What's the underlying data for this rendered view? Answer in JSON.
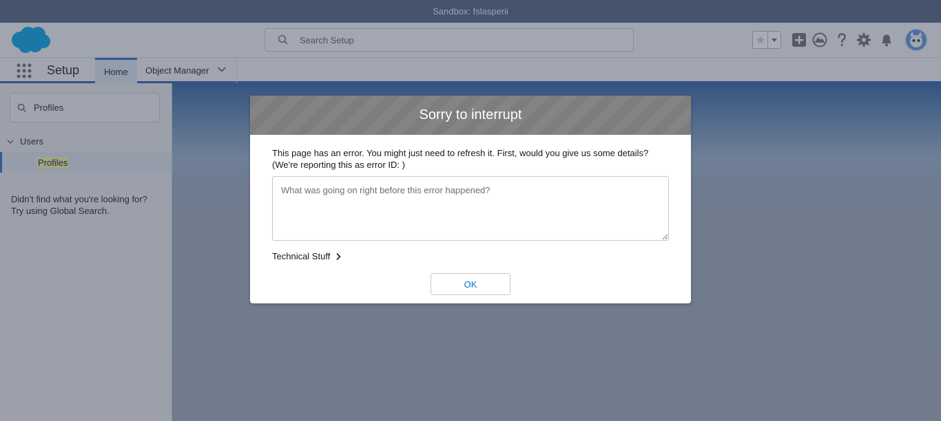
{
  "sandbox": {
    "label": "Sandbox: fslasperii"
  },
  "header": {
    "search_placeholder": "Search Setup",
    "icons": [
      "search-icon",
      "favorites-star-icon",
      "chevron-down-icon",
      "add-icon",
      "trailhead-icon",
      "help-icon",
      "gear-icon",
      "bell-icon",
      "avatar"
    ]
  },
  "context_nav": {
    "app_name": "Setup",
    "tabs": [
      {
        "label": "Home",
        "active": true
      },
      {
        "label": "Object Manager",
        "active": false
      }
    ]
  },
  "sidebar": {
    "quickfind_value": "Profiles",
    "tree": {
      "group_label": "Users",
      "item_label": "Profiles"
    },
    "not_found_line1": "Didn't find what you're looking for?",
    "not_found_line2": "Try using Global Search."
  },
  "modal": {
    "title": "Sorry to interrupt",
    "message_line1": "This page has an error. You might just need to refresh it. First, would you give us some details?",
    "message_line2": "(We're reporting this as error ID: )",
    "details_placeholder": "What was going on right before this error happened?",
    "technical_label": "Technical Stuff",
    "ok_label": "OK"
  },
  "colors": {
    "brand_blue": "#00a1e0",
    "link_blue": "#0070d2",
    "sandbox_bar": "#4f5d77"
  }
}
